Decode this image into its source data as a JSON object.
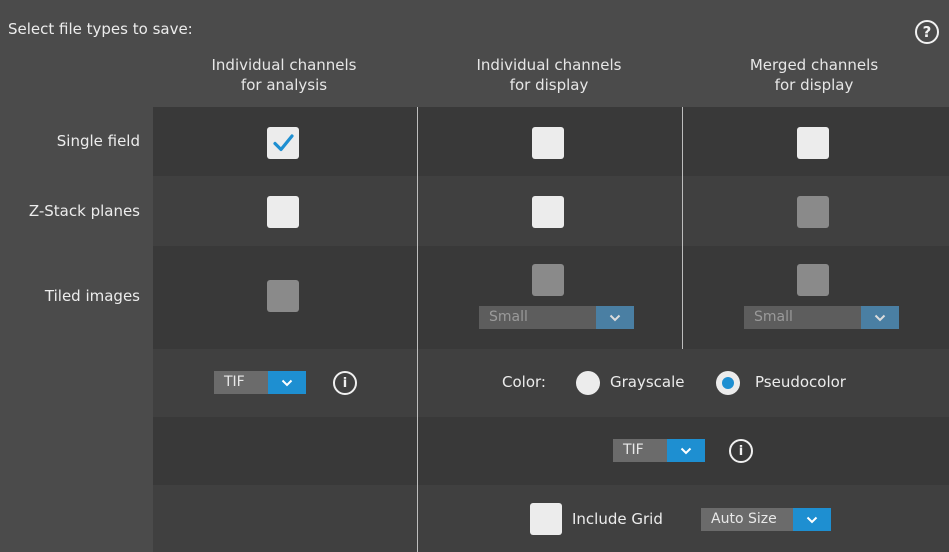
{
  "header": {
    "title": "Select file types to save:",
    "help_glyph": "?"
  },
  "columns": [
    {
      "line1": "Individual channels",
      "line2": "for analysis"
    },
    {
      "line1": "Individual channels",
      "line2": "for display"
    },
    {
      "line1": "Merged channels",
      "line2": "for display"
    }
  ],
  "rows": [
    {
      "label": "Single field"
    },
    {
      "label": "Z-Stack planes"
    },
    {
      "label": "Tiled images"
    }
  ],
  "tiled": {
    "display_size": "Small",
    "merged_size": "Small"
  },
  "analysis_format": {
    "value": "TIF",
    "info_glyph": "i"
  },
  "color": {
    "label": "Color:",
    "options": [
      "Grayscale",
      "Pseudocolor"
    ],
    "selected": "Pseudocolor"
  },
  "display_format": {
    "value": "TIF",
    "info_glyph": "i"
  },
  "grid": {
    "include_label": "Include Grid",
    "size_value": "Auto Size"
  },
  "checkboxes": {
    "single_analysis": {
      "checked": true,
      "enabled": true
    },
    "single_display": {
      "checked": false,
      "enabled": true
    },
    "single_merged": {
      "checked": false,
      "enabled": true
    },
    "zstack_analysis": {
      "checked": false,
      "enabled": true
    },
    "zstack_display": {
      "checked": false,
      "enabled": true
    },
    "zstack_merged": {
      "checked": false,
      "enabled": false
    },
    "tiled_analysis": {
      "checked": false,
      "enabled": false
    },
    "tiled_display": {
      "checked": false,
      "enabled": false
    },
    "tiled_merged": {
      "checked": false,
      "enabled": false
    },
    "include_grid": {
      "checked": false,
      "enabled": true
    }
  },
  "colors": {
    "accent": "#1e8fd1",
    "panel_dark": "#393939",
    "panel_light": "#4b4b4b"
  }
}
